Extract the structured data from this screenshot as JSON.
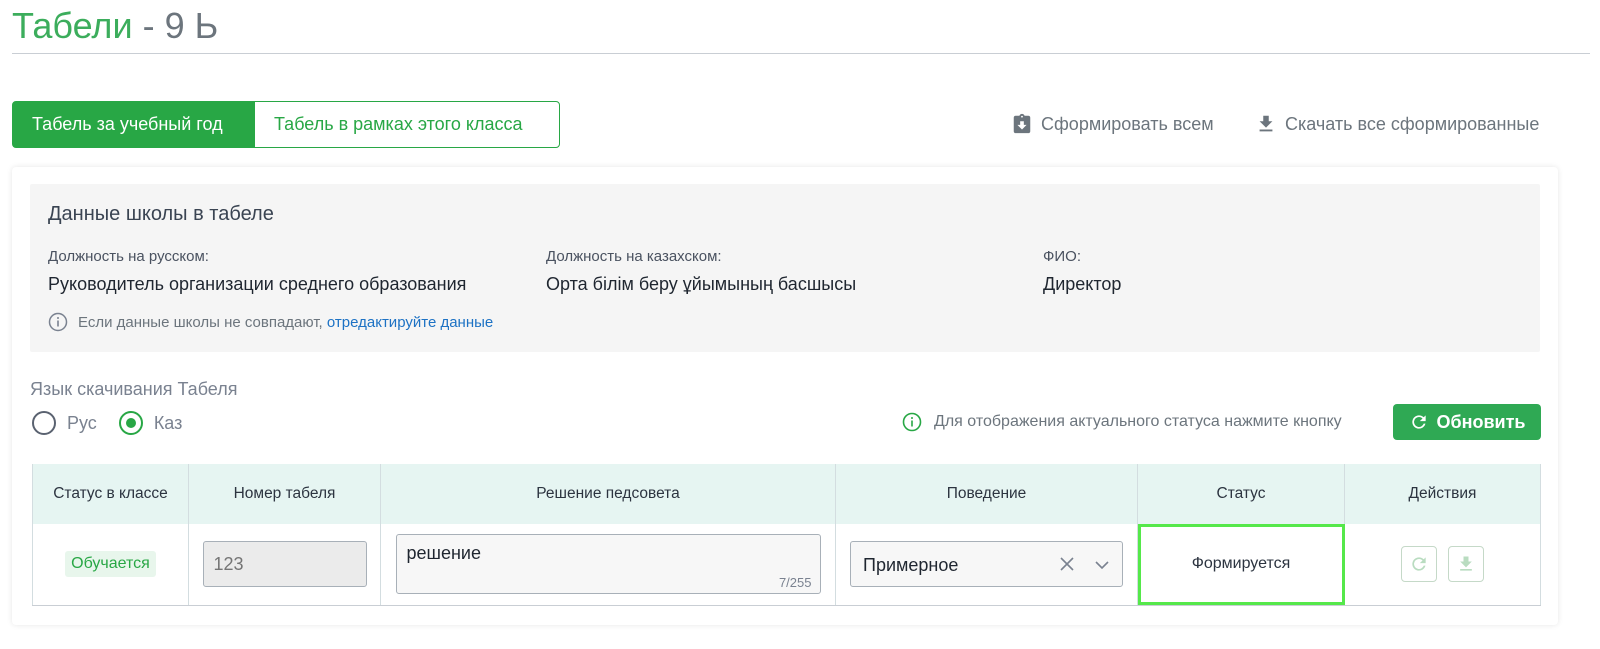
{
  "header": {
    "title_main": "Табели",
    "title_sub": "- 9 Ь"
  },
  "tabs": [
    {
      "label": "Табель за учебный год",
      "active": true
    },
    {
      "label": "Табель в рамках этого класса",
      "active": false
    }
  ],
  "actions": {
    "form_all_label": "Сформировать всем",
    "download_all_label": "Скачать все сформированные"
  },
  "school": {
    "title": "Данные школы в табеле",
    "fields": [
      {
        "label": "Должность на русском:",
        "value": "Руководитель организации среднего образования"
      },
      {
        "label": "Должность на казахском:",
        "value": "Орта білім беру ұйымының басшысы"
      },
      {
        "label": "ФИО:",
        "value": "Директор"
      }
    ],
    "note_text": "Если данные школы не совпадают,",
    "note_link": "отредактируйте данные"
  },
  "language": {
    "label": "Язык скачивания Табеля",
    "options": [
      "Рус",
      "Каз"
    ],
    "selected": "Каз"
  },
  "status_hint": "Для отображения актуального статуса нажмите кнопку",
  "refresh_label": "Обновить",
  "table": {
    "headers": [
      "Статус в классе",
      "Номер табеля",
      "Решение педсовета",
      "Поведение",
      "Статус",
      "Действия"
    ],
    "row": {
      "class_status": "Обучается",
      "number_placeholder": "123",
      "decision": "решение",
      "decision_count": "7/255",
      "behavior": "Примерное",
      "status": "Формируется"
    }
  },
  "colors": {
    "accent": "#28a745",
    "title_green": "#3cad5c",
    "link": "#1d72c4",
    "header_bg": "#e6f5f2",
    "highlight": "#55e84a"
  }
}
